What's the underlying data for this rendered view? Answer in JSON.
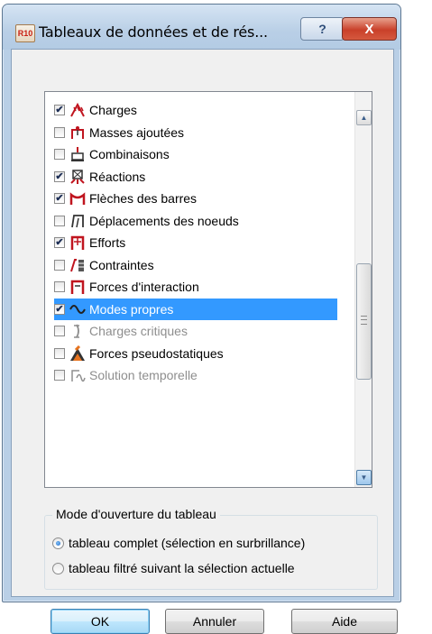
{
  "window": {
    "title": "Tableaux de données et de rés...",
    "app_icon_text": "R10",
    "help_label": "?",
    "close_label": "X"
  },
  "list": {
    "items": [
      {
        "label": "Charges",
        "checked": true,
        "icon": "loads-icon",
        "state": "normal"
      },
      {
        "label": "Masses ajoutées",
        "checked": false,
        "icon": "added-masses-icon",
        "state": "normal"
      },
      {
        "label": "Combinaisons",
        "checked": false,
        "icon": "combinations-icon",
        "state": "normal"
      },
      {
        "label": "Réactions",
        "checked": true,
        "icon": "reactions-icon",
        "state": "normal"
      },
      {
        "label": "Flèches des barres",
        "checked": true,
        "icon": "bar-deflections-icon",
        "state": "normal"
      },
      {
        "label": "Déplacements des noeuds",
        "checked": false,
        "icon": "node-displacements-icon",
        "state": "normal"
      },
      {
        "label": "Efforts",
        "checked": true,
        "icon": "forces-icon",
        "state": "normal"
      },
      {
        "label": "Contraintes",
        "checked": false,
        "icon": "stresses-icon",
        "state": "normal"
      },
      {
        "label": "Forces d'interaction",
        "checked": false,
        "icon": "interaction-forces-icon",
        "state": "normal"
      },
      {
        "label": "Modes propres",
        "checked": true,
        "icon": "eigenmodes-icon",
        "state": "selected"
      },
      {
        "label": "Charges critiques",
        "checked": false,
        "icon": "critical-loads-icon",
        "state": "disabled"
      },
      {
        "label": "Forces pseudostatiques",
        "checked": false,
        "icon": "pseudostatic-forces-icon",
        "state": "normal"
      },
      {
        "label": "Solution temporelle",
        "checked": false,
        "icon": "time-solution-icon",
        "state": "disabled"
      }
    ]
  },
  "open_mode": {
    "title": "Mode d'ouverture du tableau",
    "options": [
      {
        "label": "tableau complet (sélection en surbrillance)",
        "selected": true
      },
      {
        "label": "tableau filtré suivant la sélection actuelle",
        "selected": false
      }
    ]
  },
  "buttons": {
    "ok": "OK",
    "cancel": "Annuler",
    "help": "Aide"
  },
  "colors": {
    "selection": "#3399ff",
    "icon_red": "#c0151f",
    "frame": "#b9cfe6"
  }
}
